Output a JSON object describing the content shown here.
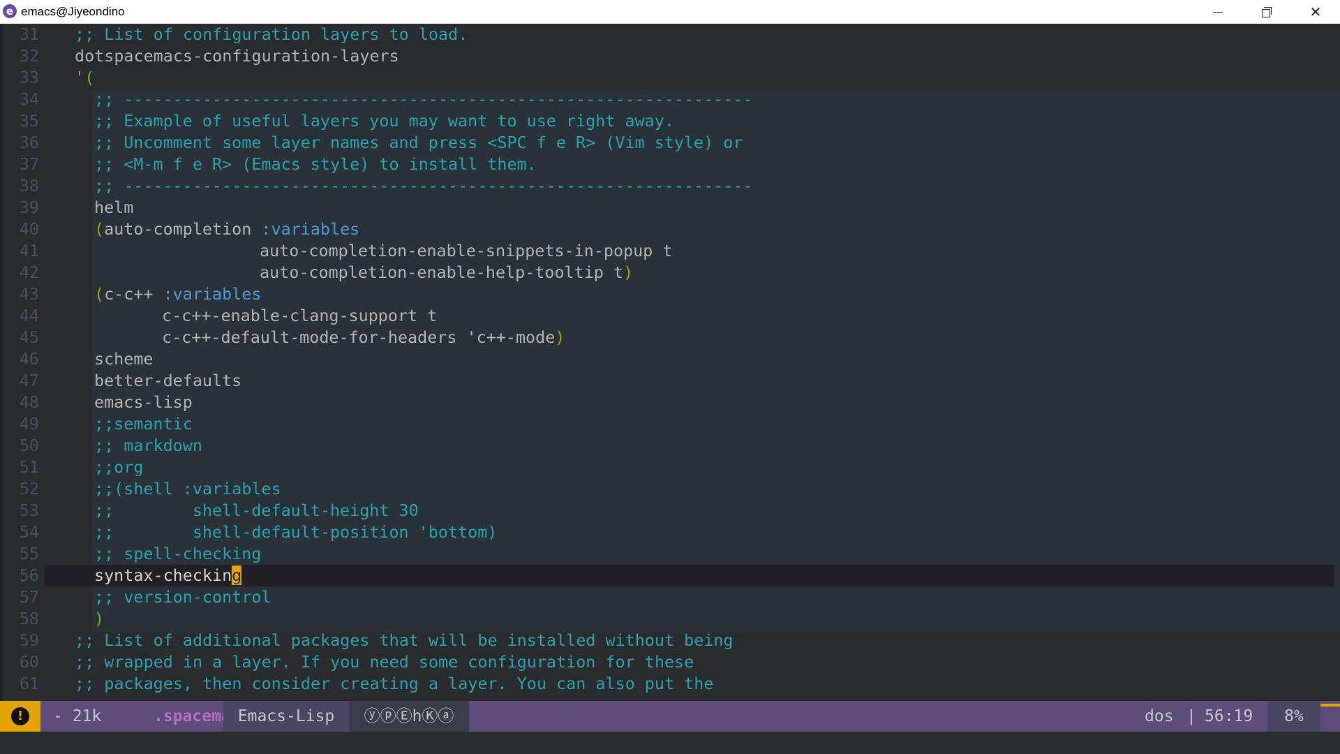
{
  "window": {
    "icon": "emacs-icon",
    "title": "emacs@Jiyeondino",
    "minimize_glyph": "",
    "close_glyph": "✕"
  },
  "editor": {
    "lines": [
      {
        "num": "31"
      },
      {
        "num": "32"
      },
      {
        "num": "33"
      },
      {
        "num": "34"
      },
      {
        "num": "35"
      },
      {
        "num": "36"
      },
      {
        "num": "37"
      },
      {
        "num": "38"
      },
      {
        "num": "39"
      },
      {
        "num": "40"
      },
      {
        "num": "41"
      },
      {
        "num": "42"
      },
      {
        "num": "43"
      },
      {
        "num": "44"
      },
      {
        "num": "45"
      },
      {
        "num": "46"
      },
      {
        "num": "47"
      },
      {
        "num": "48"
      },
      {
        "num": "49"
      },
      {
        "num": "50"
      },
      {
        "num": "51"
      },
      {
        "num": "52"
      },
      {
        "num": "53"
      },
      {
        "num": "54"
      },
      {
        "num": "55"
      },
      {
        "num": "56"
      },
      {
        "num": "57"
      },
      {
        "num": "58"
      },
      {
        "num": "59"
      },
      {
        "num": "60"
      },
      {
        "num": "61"
      }
    ],
    "text": {
      "l31": ";; List of configuration layers to load.",
      "l32": "dotspacemacs-configuration-layers",
      "l33_q": "'",
      "l33_p": "(",
      "l34": ";; ----------------------------------------------------------------",
      "l35": ";; Example of useful layers you may want to use right away.",
      "l36": ";; Uncomment some layer names and press <SPC f e R> (Vim style) or",
      "l37": ";; <M-m f e R> (Emacs style) to install them.",
      "l38": ";; ----------------------------------------------------------------",
      "l39": "helm",
      "l40_p": "(",
      "l40_a": "auto-completion ",
      "l40_k": ":variables",
      "l41": "auto-completion-enable-snippets-in-popup t",
      "l42_a": "auto-completion-enable-help-tooltip t",
      "l42_p": ")",
      "l43_p": "(",
      "l43_a": "c-c++ ",
      "l43_k": ":variables",
      "l44": "c-c++-enable-clang-support t",
      "l45_a": "c-c++-default-mode-for-headers 'c++-mode",
      "l45_p": ")",
      "l46": "scheme",
      "l47": "better-defaults",
      "l48": "emacs-lisp",
      "l49": ";;semantic",
      "l50": ";; markdown",
      "l51": ";;org",
      "l52": ";;(shell :variables",
      "l53": ";;        shell-default-height 30",
      "l54": ";;        shell-default-position 'bottom)",
      "l55": ";; spell-checking",
      "l56_a": "syntax-checkin",
      "l56_c": "g",
      "l57": ";; version-control",
      "l58": ")",
      "l59": ";; List of additional packages that will be installed without being",
      "l60": ";; wrapped in a layer. If you need some configuration for these",
      "l61": ";; packages, then consider creating a layer. You can also put the"
    }
  },
  "modeline": {
    "state_icon": "!",
    "modified": "- 21k",
    "buffer_name": ".spacemacs",
    "major_mode": "Emacs-Lisp",
    "minor_modes": "ⓨⓟⒺhⓀⓐ",
    "encoding": "dos",
    "separator": "|",
    "position": "56:19",
    "percent": "8%"
  },
  "colors": {
    "background": "#292b2e",
    "comment": "#2aa1ae",
    "keyword": "#4f97d7",
    "cursor": "#e3a400",
    "modeline": "#5d4d7a"
  }
}
